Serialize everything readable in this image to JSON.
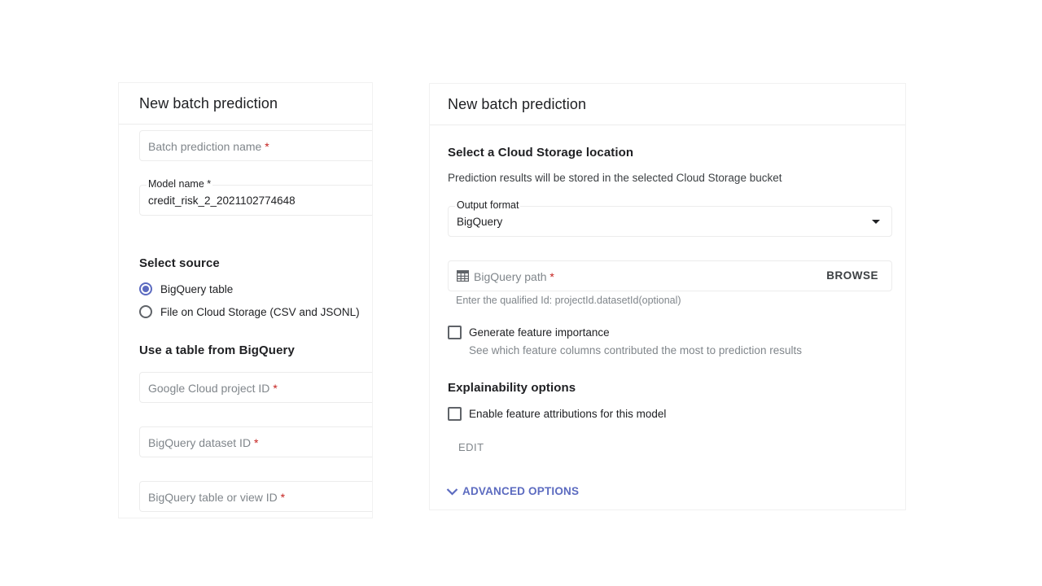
{
  "left_panel": {
    "title": "New batch prediction",
    "batch_name_field": {
      "placeholder": "Batch prediction name",
      "required_mark": "*"
    },
    "model_name_field": {
      "label": "Model name *",
      "value": "credit_risk_2_2021102774648"
    },
    "select_source": {
      "title": "Select source",
      "options": [
        {
          "label": "BigQuery table",
          "checked": true
        },
        {
          "label": "File on Cloud Storage (CSV and JSONL)",
          "checked": false
        }
      ]
    },
    "bigquery_section": {
      "title": "Use a table from BigQuery",
      "project_field": {
        "placeholder": "Google Cloud project ID",
        "required_mark": "*"
      },
      "dataset_field": {
        "placeholder": "BigQuery dataset ID",
        "required_mark": "*"
      },
      "table_field": {
        "placeholder": "BigQuery table or view ID",
        "required_mark": "*"
      }
    }
  },
  "right_panel": {
    "title": "New batch prediction",
    "storage_section": {
      "title": "Select a Cloud Storage location",
      "description": "Prediction results will be stored in the selected Cloud Storage bucket"
    },
    "output_format": {
      "label": "Output format",
      "value": "BigQuery"
    },
    "bigquery_path": {
      "placeholder": "BigQuery path",
      "required_mark": "*",
      "browse_label": "BROWSE",
      "hint": "Enter the qualified Id: projectId.datasetId(optional)"
    },
    "feature_importance": {
      "label": "Generate feature importance",
      "checked": false,
      "description": "See which feature columns contributed the most to prediction results"
    },
    "explainability": {
      "title": "Explainability options",
      "checkbox_label": "Enable feature attributions for this model",
      "checked": false,
      "edit_label": "EDIT"
    },
    "advanced_options_label": "ADVANCED OPTIONS"
  },
  "colors": {
    "accent": "#5c6bc0",
    "required": "#c5221f",
    "border": "#ececec",
    "muted_text": "#80868b"
  }
}
